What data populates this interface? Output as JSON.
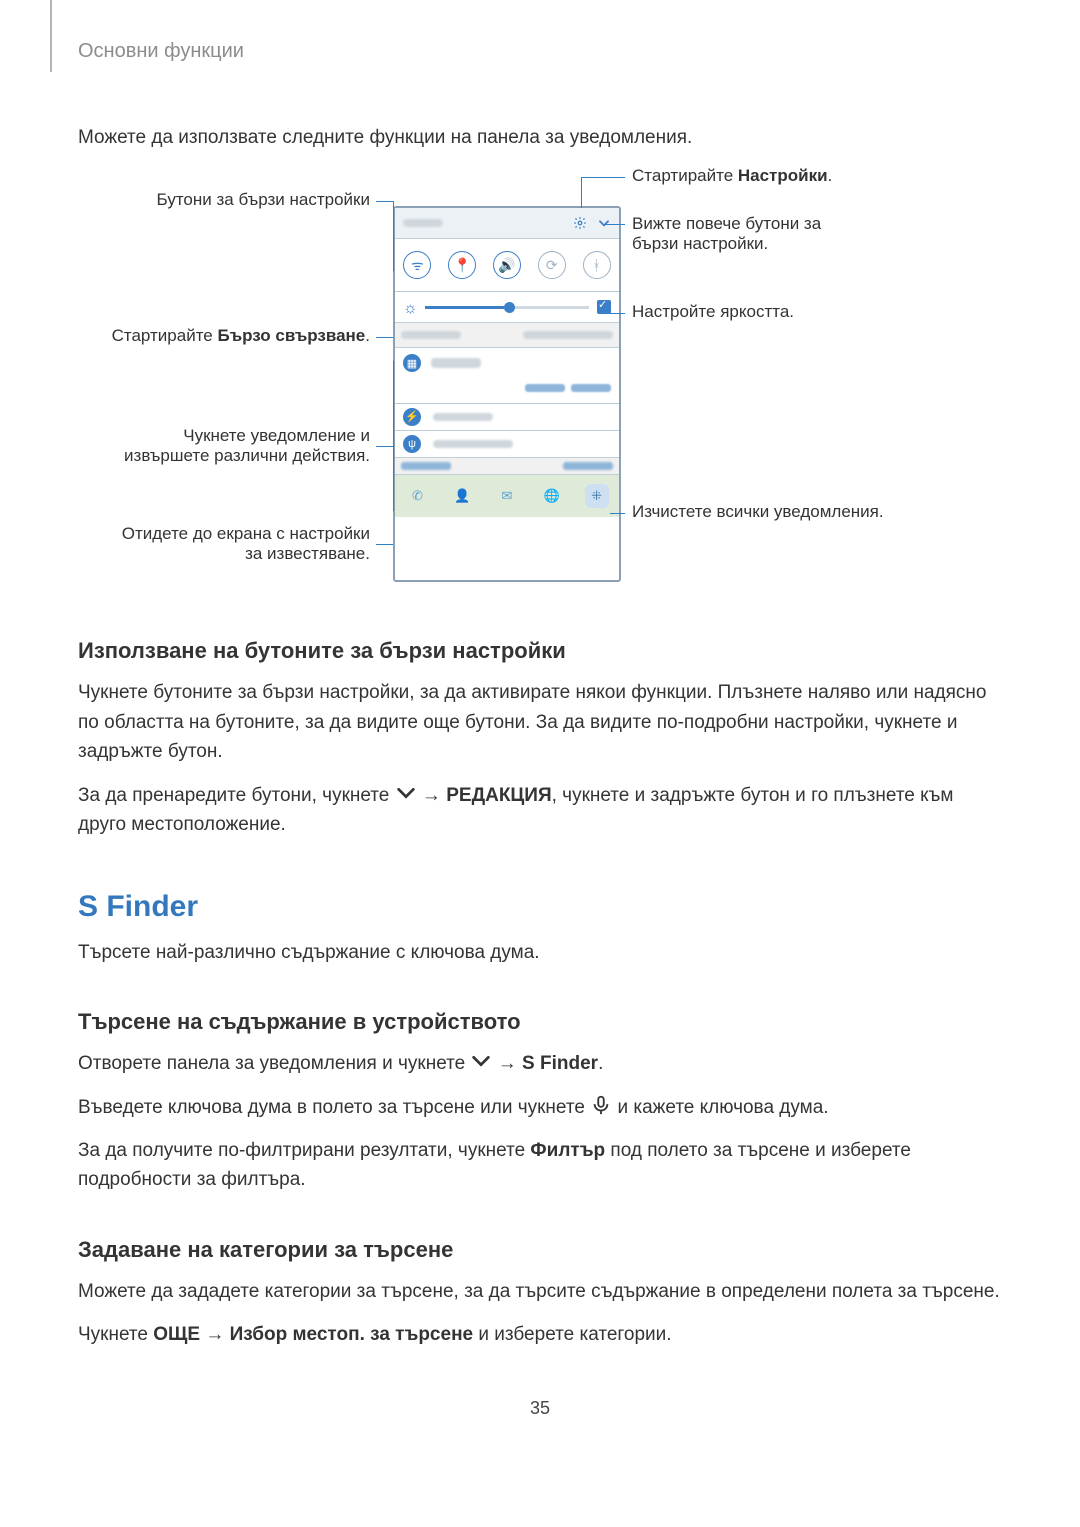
{
  "running_header": "Основни функции",
  "intro": "Можете да използвате следните функции на панела за уведомления.",
  "annotations": {
    "left1": "Бутони за бързи настройки",
    "left2_pre": "Стартирайте ",
    "left2_bold": "Бързо свързване",
    "left2_post": ".",
    "left3": "Чукнете уведомление и извършете различни действия.",
    "left4": "Отидете до екрана с настройки за известяване.",
    "right1_pre": "Стартирайте ",
    "right1_bold": "Настройки",
    "right1_post": ".",
    "right2": "Вижте повече бутони за бързи настройки.",
    "right3": "Настройте яркостта.",
    "right4": "Изчистете всички уведомления."
  },
  "sec1": {
    "title": "Използване на бутоните за бързи настройки",
    "p1": "Чукнете бутоните за бързи настройки, за да активирате някои функции. Плъзнете наляво или надясно по областта на бутоните, за да видите още бутони. За да видите по-подробни настройки, чукнете и задръжте бутон.",
    "p2_pre": "За да пренаредите бутони, чукнете ",
    "p2_arrow": " → ",
    "p2_bold": "РЕДАКЦИЯ",
    "p2_post": ", чукнете и задръжте бутон и го плъзнете към друго местоположение."
  },
  "sfinder": {
    "title": "S Finder",
    "sub": "Търсете най-различно съдържание с ключова дума."
  },
  "sec2": {
    "title": "Търсене на съдържание в устройството",
    "p1_pre": "Отворете панела за уведомления и чукнете ",
    "p1_arrow": " → ",
    "p1_bold": "S Finder",
    "p1_post": ".",
    "p2_pre": "Въведете ключова дума в полето за търсене или чукнете ",
    "p2_post": " и кажете ключова дума.",
    "p3_pre": "За да получите по-филтрирани резултати, чукнете ",
    "p3_bold": "Филтър",
    "p3_post": " под полето за търсене и изберете подробности за филтъра."
  },
  "sec3": {
    "title": "Задаване на категории за търсене",
    "p1": "Можете да зададете категории за търсене, за да търсите съдържание в определени полета за търсене.",
    "p2_pre": "Чукнете ",
    "p2_b1": "ОЩЕ",
    "p2_mid": " → ",
    "p2_b2": "Избор местоп. за търсене",
    "p2_post": " и изберете категории."
  },
  "page_number": "35"
}
